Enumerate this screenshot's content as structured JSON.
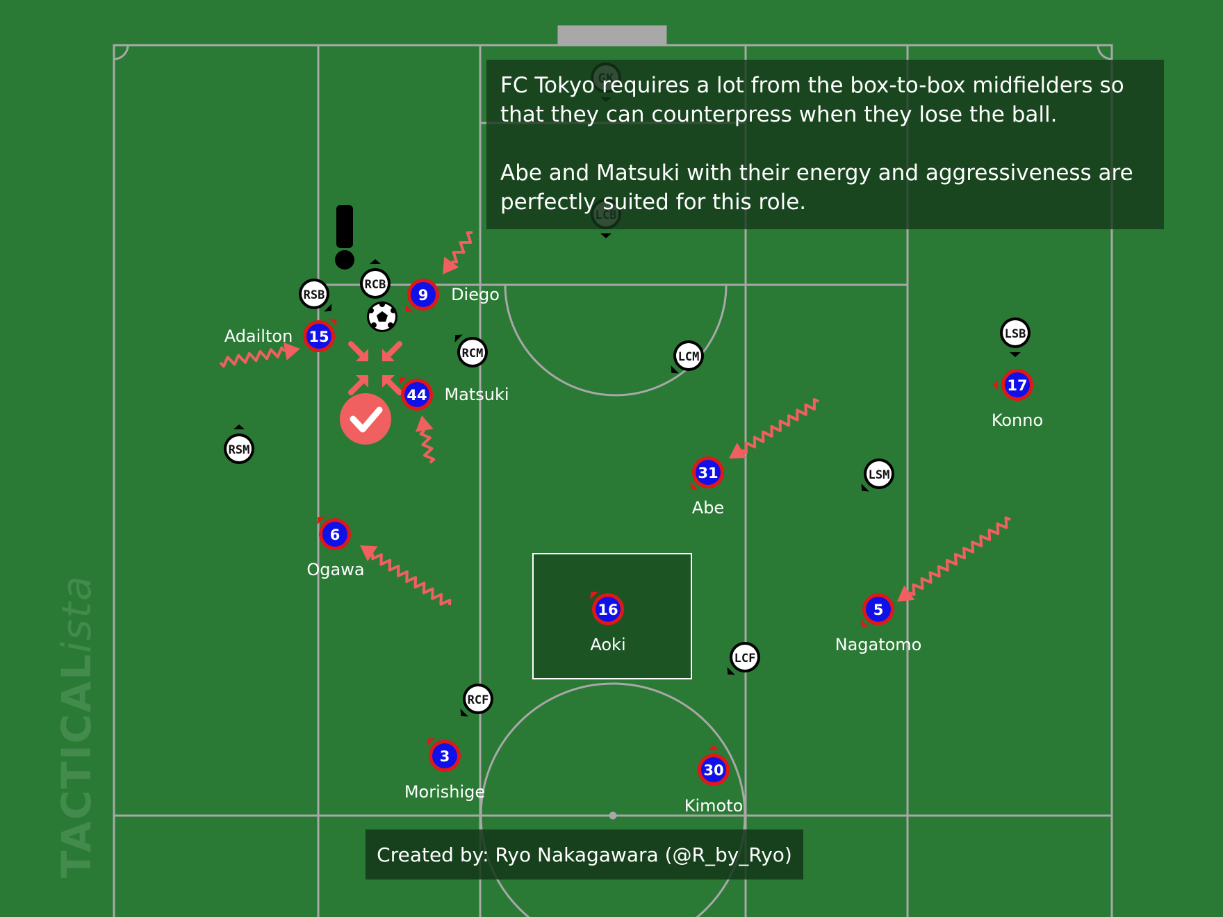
{
  "colors": {
    "pitch": "#2a7a35",
    "lines": "#a8a8a8",
    "home_fill": "#1010e8",
    "home_ring": "#e01818",
    "away_fill": "#ffffff",
    "keeper_fill": "#9a9a9a",
    "arrow": "#f06060"
  },
  "annotation": {
    "paragraph1": "FC Tokyo requires a lot from the box-to-box midfielders so that they can counterpress when they lose the ball.",
    "paragraph2": "Abe and Matsuki with their energy and aggressiveness are perfectly suited for this role."
  },
  "credit": "Created by: Ryo Nakagawara (@R_by_Ryo)",
  "watermark": {
    "bold": "TACTICAL",
    "light": "ista"
  },
  "home_players": [
    {
      "number": "9",
      "name": "Diego"
    },
    {
      "number": "15",
      "name": "Adailton"
    },
    {
      "number": "44",
      "name": "Matsuki"
    },
    {
      "number": "17",
      "name": "Konno"
    },
    {
      "number": "31",
      "name": "Abe"
    },
    {
      "number": "6",
      "name": "Ogawa"
    },
    {
      "number": "16",
      "name": "Aoki"
    },
    {
      "number": "5",
      "name": "Nagatomo"
    },
    {
      "number": "3",
      "name": "Morishige"
    },
    {
      "number": "30",
      "name": "Kimoto"
    }
  ],
  "away_players": [
    "GK",
    "LCB",
    "RSB",
    "RCB",
    "RCM",
    "LCM",
    "LSB",
    "RSM",
    "LSM",
    "RCF",
    "LCF"
  ],
  "icons": [
    "ball-icon",
    "exclamation-icon",
    "check-icon",
    "compress-arrows-icon",
    "squiggle-arrow-icon"
  ]
}
